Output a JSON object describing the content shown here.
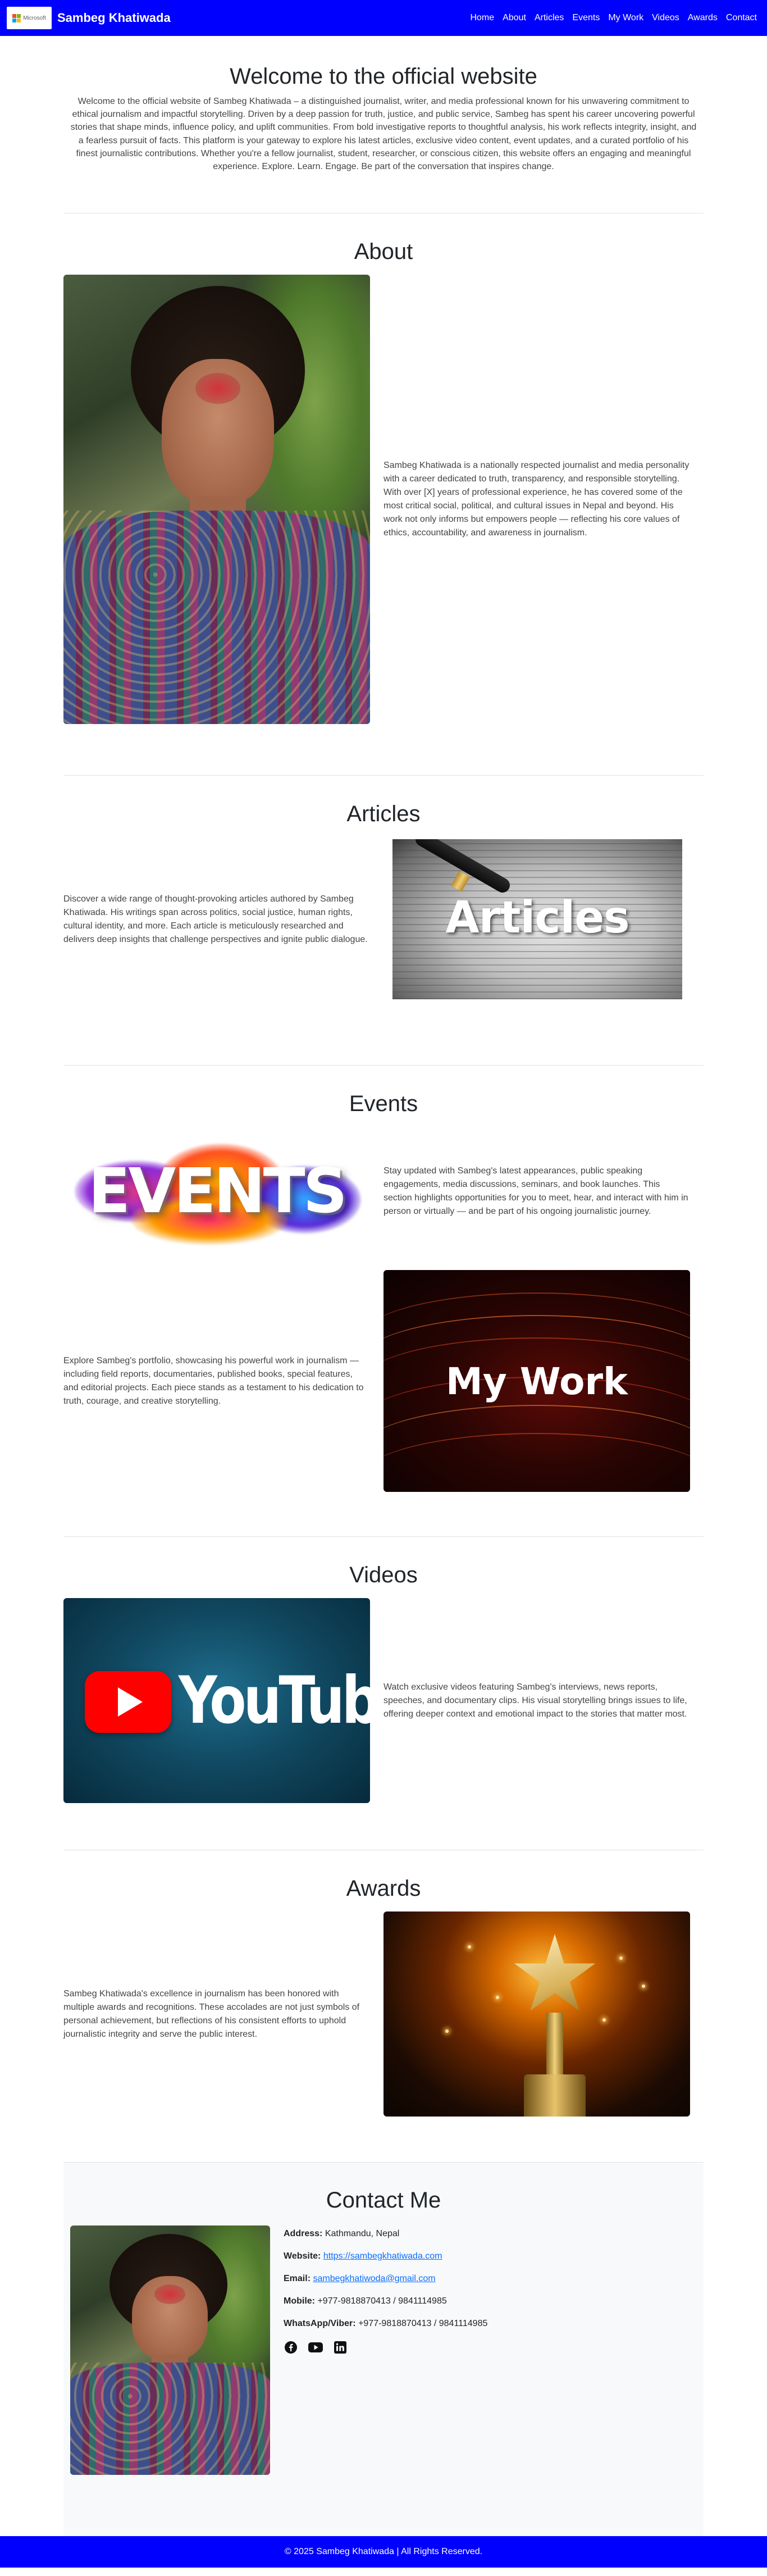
{
  "colors": {
    "nav_bg": "#0000ff",
    "footer_bg": "#0000ff",
    "link": "#0d6efd",
    "section_bg": "#f8f9fa"
  },
  "navbar": {
    "logo_icon": "microsoft-logo",
    "logo_text": "Microsoft",
    "brand": "Sambeg Khatiwada",
    "links": [
      "Home",
      "About",
      "Articles",
      "Events",
      "My Work",
      "Videos",
      "Awards",
      "Contact"
    ]
  },
  "hero": {
    "title": "Welcome to the official website",
    "text": "Welcome to the official website of Sambeg Khatiwada – a distinguished journalist, writer, and media professional known for his unwavering commitment to ethical journalism and impactful storytelling. Driven by a deep passion for truth, justice, and public service, Sambeg has spent his career uncovering powerful stories that shape minds, influence policy, and uplift communities. From bold investigative reports to thoughtful analysis, his work reflects integrity, insight, and a fearless pursuit of facts. This platform is your gateway to explore his latest articles, exclusive video content, event updates, and a curated portfolio of his finest journalistic contributions. Whether you're a fellow journalist, student, researcher, or conscious citizen, this website offers an engaging and meaningful experience. Explore. Learn. Engage. Be part of the conversation that inspires change."
  },
  "about": {
    "title": "About",
    "text": "Sambeg Khatiwada is a nationally respected journalist and media personality with a career dedicated to truth, transparency, and responsible storytelling. With over [X] years of professional experience, he has covered some of the most critical social, political, and cultural issues in Nepal and beyond. His work not only informs but empowers people — reflecting his core values of ethics, accountability, and awareness in journalism."
  },
  "articles": {
    "title": "Articles",
    "image_word": "Articles",
    "text": "Discover a wide range of thought-provoking articles authored by Sambeg Khatiwada. His writings span across politics, social justice, human rights, cultural identity, and more. Each article is meticulously researched and delivers deep insights that challenge perspectives and ignite public dialogue."
  },
  "events": {
    "title": "Events",
    "image_word": "EVENTS",
    "text": "Stay updated with Sambeg's latest appearances, public speaking engagements, media discussions, seminars, and book launches. This section highlights opportunities for you to meet, hear, and interact with him in person or virtually — and be part of his ongoing journalistic journey."
  },
  "mywork": {
    "image_word": "My Work",
    "text": "Explore Sambeg's portfolio, showcasing his powerful work in journalism — including field reports, documentaries, published books, special features, and editorial projects. Each piece stands as a testament to his dedication to truth, courage, and creative storytelling."
  },
  "videos": {
    "title": "Videos",
    "image_word": "YouTube",
    "text": "Watch exclusive videos featuring Sambeg's interviews, news reports, speeches, and documentary clips. His visual storytelling brings issues to life, offering deeper context and emotional impact to the stories that matter most."
  },
  "awards": {
    "title": "Awards",
    "text": "Sambeg Khatiwada's excellence in journalism has been honored with multiple awards and recognitions. These accolades are not just symbols of personal achievement, but reflections of his consistent efforts to uphold journalistic integrity and serve the public interest."
  },
  "contact": {
    "title": "Contact Me",
    "address_label": "Address:",
    "address": "Kathmandu, Nepal",
    "website_label": "Website:",
    "website": "https://sambegkhatiwada.com",
    "email_label": "Email:",
    "email": "sambegkhatiwoda@gmail.com",
    "mobile_label": "Mobile:",
    "mobile": "+977-9818870413 / 9841114985",
    "whatsapp_label": "WhatsApp/Viber:",
    "whatsapp": "+977-9818870413 / 9841114985",
    "social_icons": [
      "facebook-icon",
      "youtube-icon",
      "linkedin-icon"
    ]
  },
  "footer": {
    "text": "© 2025 Sambeg Khatiwada | All Rights Reserved."
  }
}
